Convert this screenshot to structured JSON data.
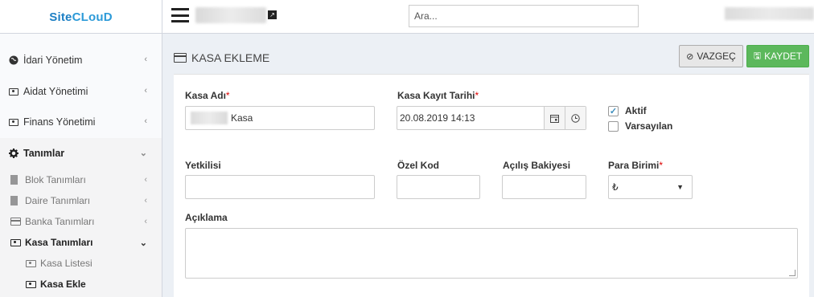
{
  "header": {
    "logo_site": "Site",
    "logo_cloud": "CLouD",
    "search_placeholder": "Ara..."
  },
  "sidebar": {
    "items": [
      {
        "label": "İdari Yönetim",
        "icon": "globe-icon"
      },
      {
        "label": "Aidat Yönetimi",
        "icon": "money-icon"
      },
      {
        "label": "Finans Yönetimi",
        "icon": "money-icon"
      },
      {
        "label": "Tanımlar",
        "icon": "gear-icon"
      }
    ],
    "sub_items": [
      {
        "label": "Blok Tanımları",
        "icon": "building-icon"
      },
      {
        "label": "Daire Tanımları",
        "icon": "building-icon"
      },
      {
        "label": "Banka Tanımları",
        "icon": "card-icon"
      },
      {
        "label": "Kasa Tanımları",
        "icon": "money-icon"
      }
    ],
    "sub_sub_items": [
      {
        "label": "Kasa Listesi",
        "icon": "money-icon"
      },
      {
        "label": "Kasa Ekle",
        "icon": "money-icon"
      }
    ]
  },
  "page": {
    "title": "KASA EKLEME",
    "cancel_label": "VAZGEÇ",
    "save_label": "KAYDET"
  },
  "form": {
    "kasa_adi_label": "Kasa Adı",
    "kasa_adi_value": "Kasa",
    "kayit_tarihi_label": "Kasa Kayıt Tarihi",
    "kayit_tarihi_value": "20.08.2019 14:13",
    "aktif_label": "Aktif",
    "aktif_checked": true,
    "varsayilan_label": "Varsayılan",
    "varsayilan_checked": false,
    "yetkilisi_label": "Yetkilisi",
    "ozel_kod_label": "Özel Kod",
    "acilis_bakiyesi_label": "Açılış Bakiyesi",
    "para_birimi_label": "Para Birimi",
    "para_birimi_value": "₺",
    "aciklama_label": "Açıklama",
    "required_mark": "*"
  },
  "colors": {
    "brand": "#1d7fc4",
    "save_button": "#5cb85c",
    "required": "#dd0000"
  }
}
